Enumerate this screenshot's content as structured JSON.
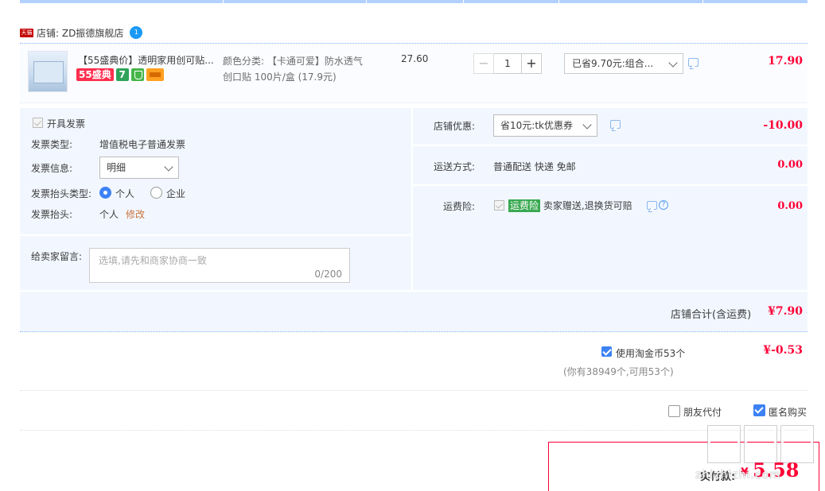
{
  "shop": {
    "badge": "天猫",
    "name": "店铺: ZD振德旗舰店",
    "wangwang": "1"
  },
  "item": {
    "title": "【55盛典价】透明家用创可贴...",
    "badges": {
      "festival": "55盛典",
      "seven": "7"
    },
    "sku_line1": "颜色分类: 【卡通可爱】防水透气",
    "sku_line2": "创口贴 100片/盒 (17.9元)",
    "unit_price": "27.60",
    "quantity": "1",
    "minus": "−",
    "plus": "+",
    "promo": "已省9.70元:组合...",
    "total": "17.90"
  },
  "invoice": {
    "open_label": "开具发票",
    "type_label": "发票类型:",
    "type_value": "增值税电子普通发票",
    "info_label": "发票信息:",
    "info_value": "明细",
    "header_type_label": "发票抬头类型:",
    "personal": "个人",
    "company": "企业",
    "header_label": "发票抬头:",
    "header_value": "个人",
    "edit": "修改"
  },
  "memo": {
    "label": "给卖家留言:",
    "placeholder": "选填,请先和商家协商一致",
    "count": "0/200"
  },
  "shop_discount": {
    "label": "店铺优惠:",
    "value": "省10元:tk优惠券",
    "amount": "-10.00"
  },
  "shipping": {
    "label": "运送方式:",
    "value": "普通配送 快递 免邮",
    "amount": "0.00"
  },
  "insurance": {
    "label": "运费险:",
    "tag": "运费险",
    "text": "卖家赠送,退换货可赔",
    "help": "?",
    "amount": "0.00"
  },
  "shop_total": {
    "label": "店铺合计(含运费)",
    "value": "¥7.90"
  },
  "coins": {
    "label": "使用淘金币53个",
    "sub": "(你有38949个,可用53个)",
    "amount": "¥-0.53"
  },
  "options": {
    "friend_pay": "朋友代付",
    "anonymous": "匿名购买"
  },
  "payment": {
    "label": "实付款:",
    "yen": "¥",
    "value": "5.58"
  },
  "watermark": {
    "text": "zhizhizhi.com"
  },
  "colors": {
    "accent": "#ff0036",
    "panel": "#f2f7ff",
    "checkbox": "#3d82f5"
  }
}
